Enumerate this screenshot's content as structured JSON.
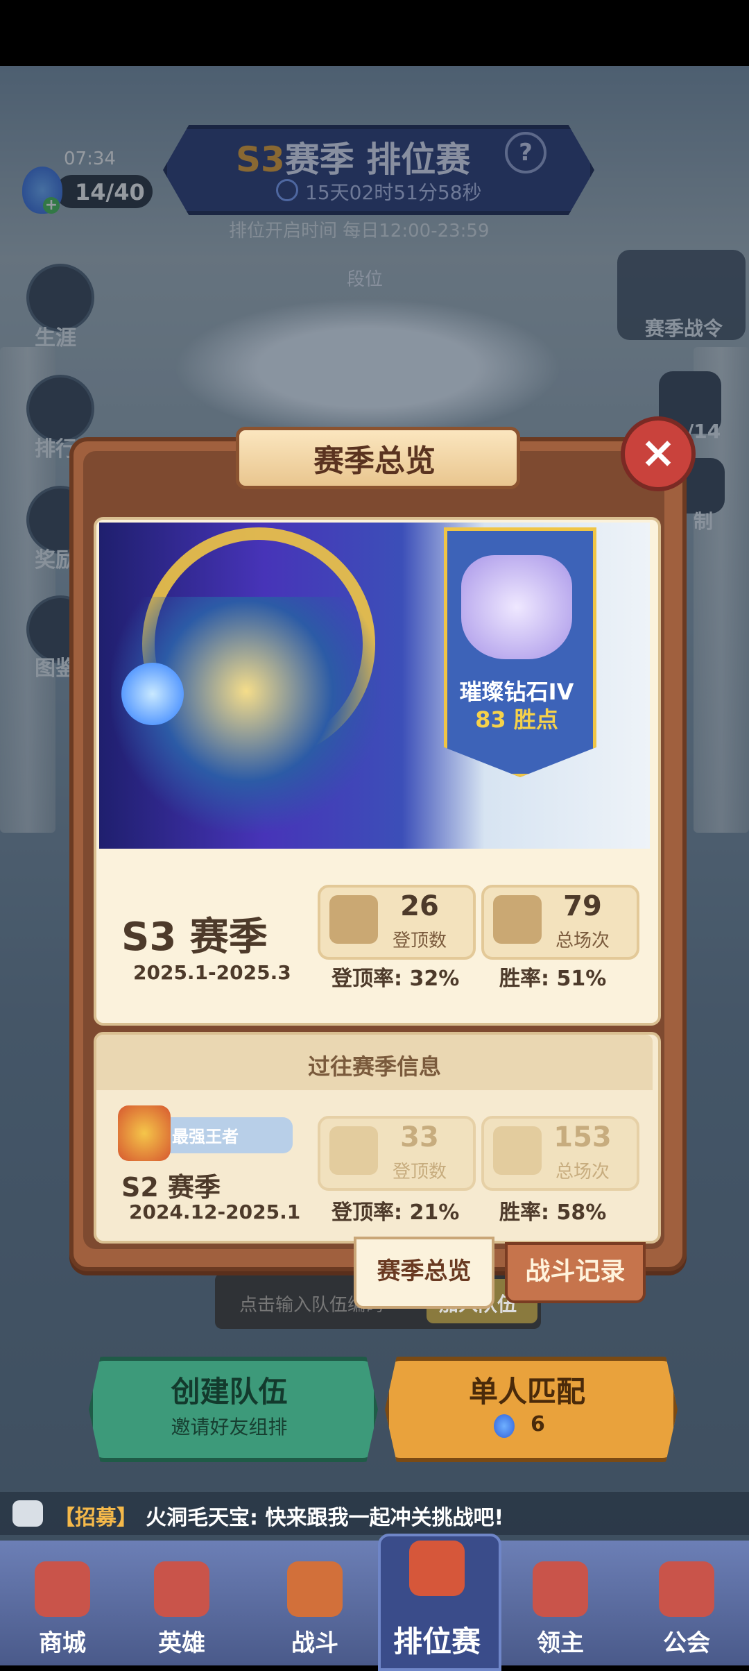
{
  "status": {
    "time": "07:34"
  },
  "energy": {
    "value": "14/40"
  },
  "header": {
    "season_code": "S3",
    "title": "赛季 排位赛",
    "countdown": "15天02时51分58秒",
    "open_time": "排位开启时间 每日12:00-23:59"
  },
  "side_left": [
    "生涯",
    "排行",
    "奖励",
    "图鉴"
  ],
  "rank_tab": "段位",
  "side_right": {
    "pass": "赛季战令",
    "count": "/14",
    "other": "制"
  },
  "modal": {
    "title": "赛季总览",
    "close": "×",
    "current": {
      "rank_name": "璀璨钻石IV",
      "points": "83 胜点",
      "season": "S3 赛季",
      "dates": "2025.1-2025.3",
      "tops": "26",
      "tops_label": "登顶数",
      "total": "79",
      "total_label": "总场次",
      "top_rate": "登顶率: 32%",
      "win_rate": "胜率: 51%"
    },
    "past_title": "过往赛季信息",
    "past": {
      "badge": "最强王者",
      "season": "S2 赛季",
      "dates": "2024.12-2025.1",
      "tops": "33",
      "tops_label": "登顶数",
      "total": "153",
      "total_label": "总场次",
      "top_rate": "登顶率: 21%",
      "win_rate": "胜率: 58%"
    },
    "tabs": {
      "overview": "赛季总览",
      "battle": "战斗记录"
    }
  },
  "team": {
    "input_placeholder": "点击输入队伍编码",
    "join": "加入队伍"
  },
  "buttons": {
    "create": "创建队伍",
    "create_sub": "邀请好友组排",
    "solo": "单人匹配",
    "solo_cost": "6"
  },
  "chat": {
    "tag": "【招募】",
    "message": "火洞毛天宝: 快来跟我一起冲关挑战吧!"
  },
  "nav": [
    "商城",
    "英雄",
    "战斗",
    "排位赛",
    "领主",
    "公会"
  ],
  "colors": {
    "accent_gold": "#e9a437",
    "modal_wood": "#a0603e",
    "battle_tab": "#c6744c"
  }
}
